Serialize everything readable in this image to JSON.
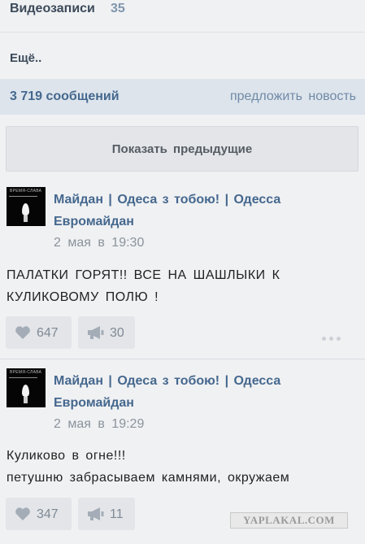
{
  "sections": {
    "videos": {
      "label": "Видеозаписи",
      "count": "35"
    },
    "more": {
      "label": "Ещё.."
    }
  },
  "wall": {
    "messages_count": "3 719 сообщений",
    "suggest_news": "предложить новость",
    "show_previous": "Показать предыдущие"
  },
  "posts": [
    {
      "author": "Майдан | Одеса з тобою! | Одесса Евромайдан",
      "date": "2 мая в 19:30",
      "text_lines": [
        "ПАЛАТКИ ГОРЯТ!! ВСЕ НА ШАШЛЫКИ К",
        "КУЛИКОВОМУ ПОЛЮ !"
      ],
      "likes": "647",
      "shares": "30",
      "avatar_caption": "ВРЕМЯ-СЛАВА"
    },
    {
      "author": "Майдан | Одеса з тобою! | Одесса Евромайдан",
      "date": "2 мая в 19:29",
      "text_lines": [
        "Куликово в огне!!!",
        "петушню забрасываем камнями, окружаем"
      ],
      "likes": "347",
      "shares": "11",
      "avatar_caption": "ВРЕМЯ-СЛАВА"
    }
  ],
  "watermark": "YAPLAKAL.COM",
  "colors": {
    "link": "#45688e",
    "background": "#f0f1f3",
    "header_band": "#dde4ec",
    "button": "#e3e5e8"
  },
  "icons": {
    "like": "heart-icon",
    "share": "megaphone-icon",
    "more": "more-dots-icon"
  }
}
